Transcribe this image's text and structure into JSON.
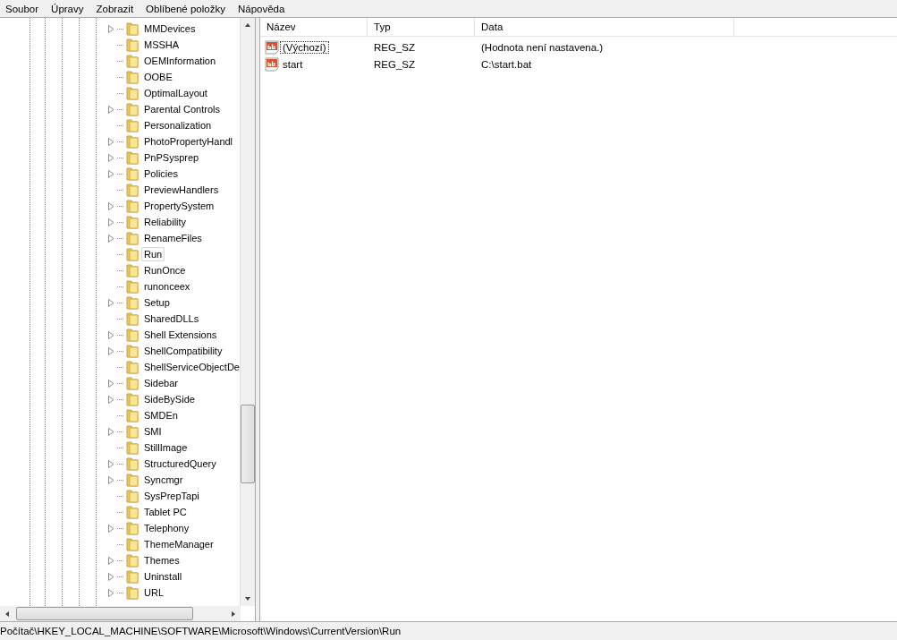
{
  "menu": [
    "Soubor",
    "Úpravy",
    "Zobrazit",
    "Oblíbené položky",
    "Nápověda"
  ],
  "tree": [
    {
      "label": "MMDevices",
      "expandable": true,
      "selected": false
    },
    {
      "label": "MSSHA",
      "expandable": false,
      "selected": false
    },
    {
      "label": "OEMInformation",
      "expandable": false,
      "selected": false
    },
    {
      "label": "OOBE",
      "expandable": false,
      "selected": false
    },
    {
      "label": "OptimalLayout",
      "expandable": false,
      "selected": false
    },
    {
      "label": "Parental Controls",
      "expandable": true,
      "selected": false
    },
    {
      "label": "Personalization",
      "expandable": false,
      "selected": false
    },
    {
      "label": "PhotoPropertyHandl",
      "expandable": true,
      "selected": false
    },
    {
      "label": "PnPSysprep",
      "expandable": true,
      "selected": false
    },
    {
      "label": "Policies",
      "expandable": true,
      "selected": false
    },
    {
      "label": "PreviewHandlers",
      "expandable": false,
      "selected": false
    },
    {
      "label": "PropertySystem",
      "expandable": true,
      "selected": false
    },
    {
      "label": "Reliability",
      "expandable": true,
      "selected": false
    },
    {
      "label": "RenameFiles",
      "expandable": true,
      "selected": false
    },
    {
      "label": "Run",
      "expandable": false,
      "selected": true
    },
    {
      "label": "RunOnce",
      "expandable": false,
      "selected": false
    },
    {
      "label": "runonceex",
      "expandable": false,
      "selected": false
    },
    {
      "label": "Setup",
      "expandable": true,
      "selected": false
    },
    {
      "label": "SharedDLLs",
      "expandable": false,
      "selected": false
    },
    {
      "label": "Shell Extensions",
      "expandable": true,
      "selected": false
    },
    {
      "label": "ShellCompatibility",
      "expandable": true,
      "selected": false
    },
    {
      "label": "ShellServiceObjectDe",
      "expandable": false,
      "selected": false
    },
    {
      "label": "Sidebar",
      "expandable": true,
      "selected": false
    },
    {
      "label": "SideBySide",
      "expandable": true,
      "selected": false
    },
    {
      "label": "SMDEn",
      "expandable": false,
      "selected": false
    },
    {
      "label": "SMI",
      "expandable": true,
      "selected": false
    },
    {
      "label": "StillImage",
      "expandable": false,
      "selected": false
    },
    {
      "label": "StructuredQuery",
      "expandable": true,
      "selected": false
    },
    {
      "label": "Syncmgr",
      "expandable": true,
      "selected": false
    },
    {
      "label": "SysPrepTapi",
      "expandable": false,
      "selected": false
    },
    {
      "label": "Tablet PC",
      "expandable": false,
      "selected": false
    },
    {
      "label": "Telephony",
      "expandable": true,
      "selected": false
    },
    {
      "label": "ThemeManager",
      "expandable": false,
      "selected": false
    },
    {
      "label": "Themes",
      "expandable": true,
      "selected": false
    },
    {
      "label": "Uninstall",
      "expandable": true,
      "selected": false
    },
    {
      "label": "URL",
      "expandable": true,
      "selected": false
    }
  ],
  "table": {
    "columns": [
      "Název",
      "Typ",
      "Data"
    ],
    "rows": [
      {
        "name": "(Výchozí)",
        "type": "REG_SZ",
        "data": "(Hodnota není nastavena.)",
        "selected": true
      },
      {
        "name": "start",
        "type": "REG_SZ",
        "data": "C:\\start.bat",
        "selected": false
      }
    ]
  },
  "status_bar": "Počítač\\HKEY_LOCAL_MACHINE\\SOFTWARE\\Microsoft\\Windows\\CurrentVersion\\Run"
}
